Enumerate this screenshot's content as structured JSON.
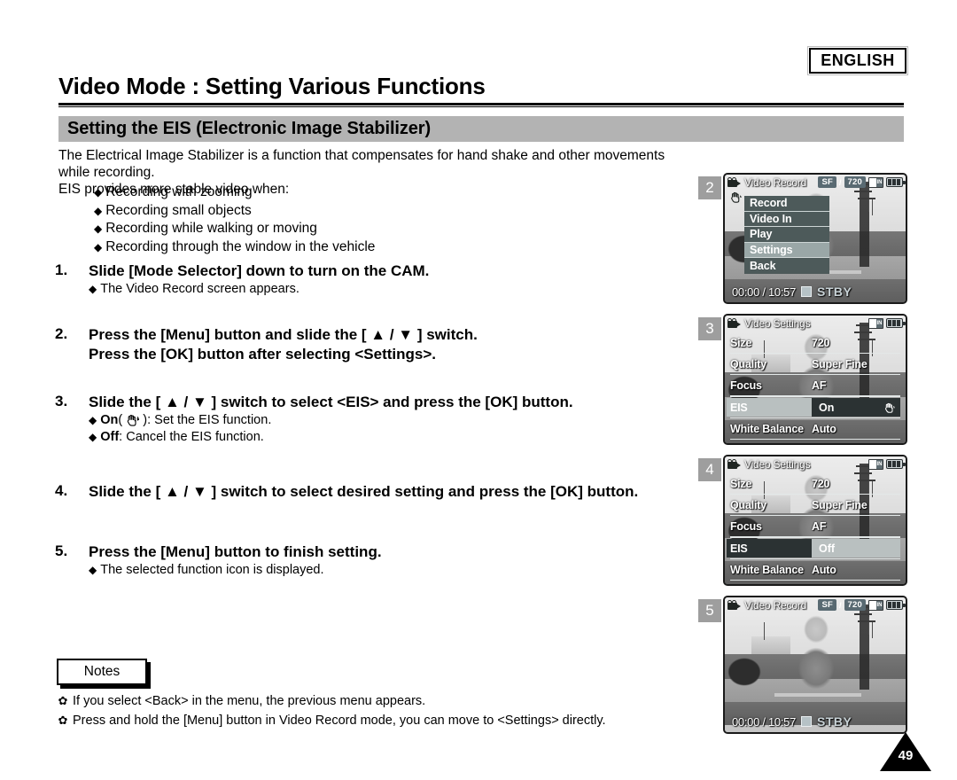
{
  "header": {
    "language_badge": "ENGLISH",
    "page_title": "Video Mode : Setting Various Functions",
    "section_title": "Setting the EIS (Electronic Image Stabilizer)"
  },
  "intro": {
    "line1": "The Electrical Image Stabilizer is a function that compensates for hand shake and other movements while recording.",
    "line2": "EIS provides more stable video when:"
  },
  "conditions": [
    "Recording with zooming",
    "Recording small objects",
    "Recording while walking or moving",
    "Recording through the window in the vehicle"
  ],
  "steps": [
    {
      "num": "1.",
      "lines": [
        "Slide [Mode Selector] down to turn on the CAM."
      ],
      "subs": [
        {
          "pre": "",
          "bold": "",
          "post": "The Video Record screen appears."
        }
      ]
    },
    {
      "num": "2.",
      "lines": [
        "Press the [Menu] button and slide the [ ▲ / ▼ ] switch.",
        "Press the [OK] button after selecting <Settings>."
      ],
      "subs": []
    },
    {
      "num": "3.",
      "lines": [
        "Slide the [ ▲ / ▼ ] switch to select <EIS> and press the [OK] button."
      ],
      "subs": [
        {
          "pre": "",
          "bold": "On",
          "post": ": Set the EIS function."
        },
        {
          "pre": "",
          "bold": "Off",
          "post": ": Cancel the EIS function."
        }
      ]
    },
    {
      "num": "4.",
      "lines": [
        "Slide the [ ▲ / ▼ ] switch to select desired setting and press the [OK] button."
      ],
      "subs": []
    },
    {
      "num": "5.",
      "lines": [
        "Press the [Menu] button to finish setting."
      ],
      "subs": [
        {
          "pre": "",
          "bold": "",
          "post": "The selected function icon is displayed."
        }
      ]
    }
  ],
  "notes": {
    "tab_label": "Notes",
    "items": [
      "If you select <Back> in the menu, the previous menu appears.",
      "Press and hold the [Menu] button in Video Record mode, you can move to <Settings> directly."
    ]
  },
  "footer": {
    "page_number": "49"
  },
  "panels": [
    {
      "badge": "2",
      "osd_title": "Video Record",
      "quality": "SF",
      "resolution": "720",
      "card_label": "IN",
      "timecode": "00:00 / 10:57",
      "status": "STBY",
      "menu": [
        {
          "label": "Record",
          "selected": false
        },
        {
          "label": "Video In",
          "selected": false
        },
        {
          "label": "Play",
          "selected": false
        },
        {
          "label": "Settings",
          "selected": true
        },
        {
          "label": "Back",
          "selected": false
        }
      ]
    },
    {
      "badge": "3",
      "osd_title": "Video Settings",
      "card_label": "IN",
      "settings": [
        {
          "label": "Size",
          "value": "720",
          "state": "normal"
        },
        {
          "label": "Quality",
          "value": "Super Fine",
          "state": "normal"
        },
        {
          "label": "Focus",
          "value": "AF",
          "state": "normal"
        },
        {
          "label": "EIS",
          "value": "On",
          "state": "eis-on"
        },
        {
          "label": "White Balance",
          "value": "Auto",
          "state": "normal"
        }
      ]
    },
    {
      "badge": "4",
      "osd_title": "Video Settings",
      "card_label": "IN",
      "settings": [
        {
          "label": "Size",
          "value": "720",
          "state": "normal"
        },
        {
          "label": "Quality",
          "value": "Super Fine",
          "state": "normal"
        },
        {
          "label": "Focus",
          "value": "AF",
          "state": "normal"
        },
        {
          "label": "EIS",
          "value": "Off",
          "state": "eis-off"
        },
        {
          "label": "White Balance",
          "value": "Auto",
          "state": "normal"
        }
      ]
    },
    {
      "badge": "5",
      "osd_title": "Video Record",
      "quality": "SF",
      "resolution": "720",
      "card_label": "IN",
      "timecode": "00:00 / 10:57",
      "status": "STBY"
    }
  ],
  "icons": {
    "camcorder": "camcorder-icon",
    "hand": "hand-eis-icon",
    "battery": "battery-icon",
    "memory_card": "memory-card-icon"
  },
  "colors": {
    "section_bar": "#b3b3b3",
    "menu_item": "#4d5a5a",
    "menu_selected": "#9aa7a7",
    "osd_chip": "#596a72",
    "badge": "#9e9e9e"
  }
}
